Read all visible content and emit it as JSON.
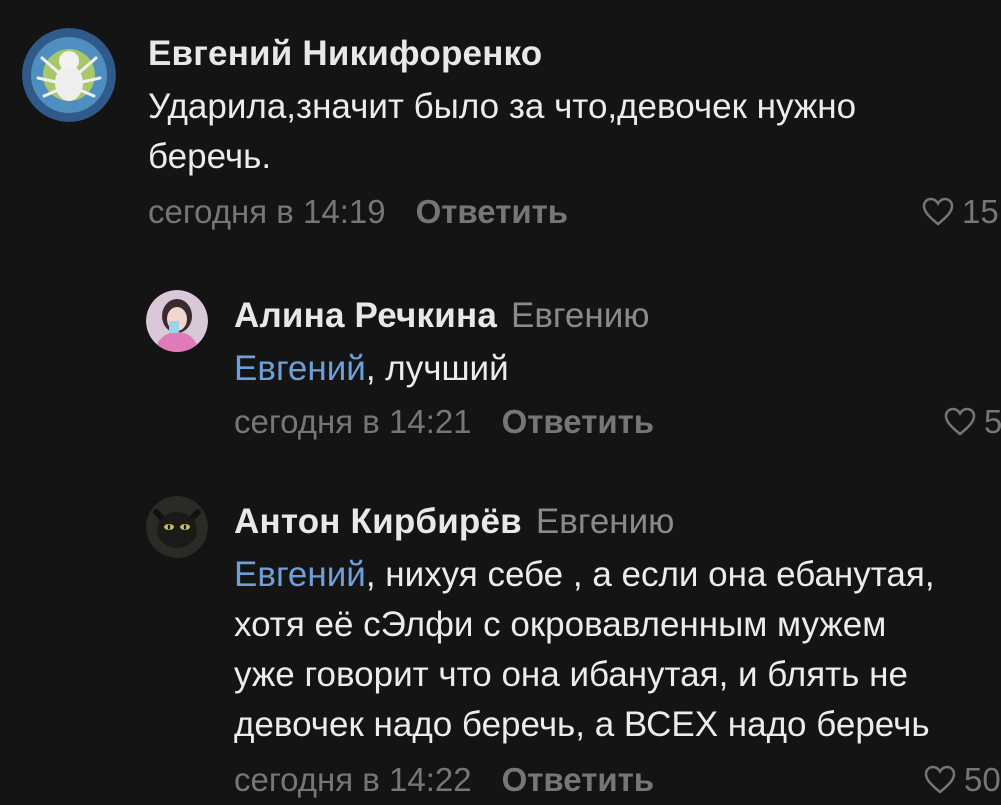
{
  "comments": [
    {
      "author": "Евгений Никифоренко",
      "reply_to": "",
      "mention": "",
      "lines": [
        "Ударила,значит было за что,девочек нужно",
        "беречь."
      ],
      "timestamp": "сегодня в 14:19",
      "reply_label": "Ответить",
      "likes": "15"
    },
    {
      "author": "Алина Речкина",
      "reply_to": "Евгению",
      "mention": "Евгений",
      "lines": [
        ", лучший"
      ],
      "timestamp": "сегодня в 14:21",
      "reply_label": "Ответить",
      "likes": "5"
    },
    {
      "author": "Антон Кирбирёв",
      "reply_to": "Евгению",
      "mention": "Евгений",
      "lines": [
        ", нихуя себе , а если она ебанутая,",
        "хотя её сЭлфи с окровавленным мужем",
        "уже говорит что она ибанутая, и блять не",
        "девочек надо беречь, а ВСЕХ надо беречь"
      ],
      "timestamp": "сегодня в 14:22",
      "reply_label": "Ответить",
      "likes": "50"
    }
  ],
  "colors": {
    "background": "#141414",
    "text": "#ececec",
    "mention": "#6f9fd8",
    "muted": "#767676"
  },
  "icons": {
    "like": "heart-outline-icon"
  }
}
